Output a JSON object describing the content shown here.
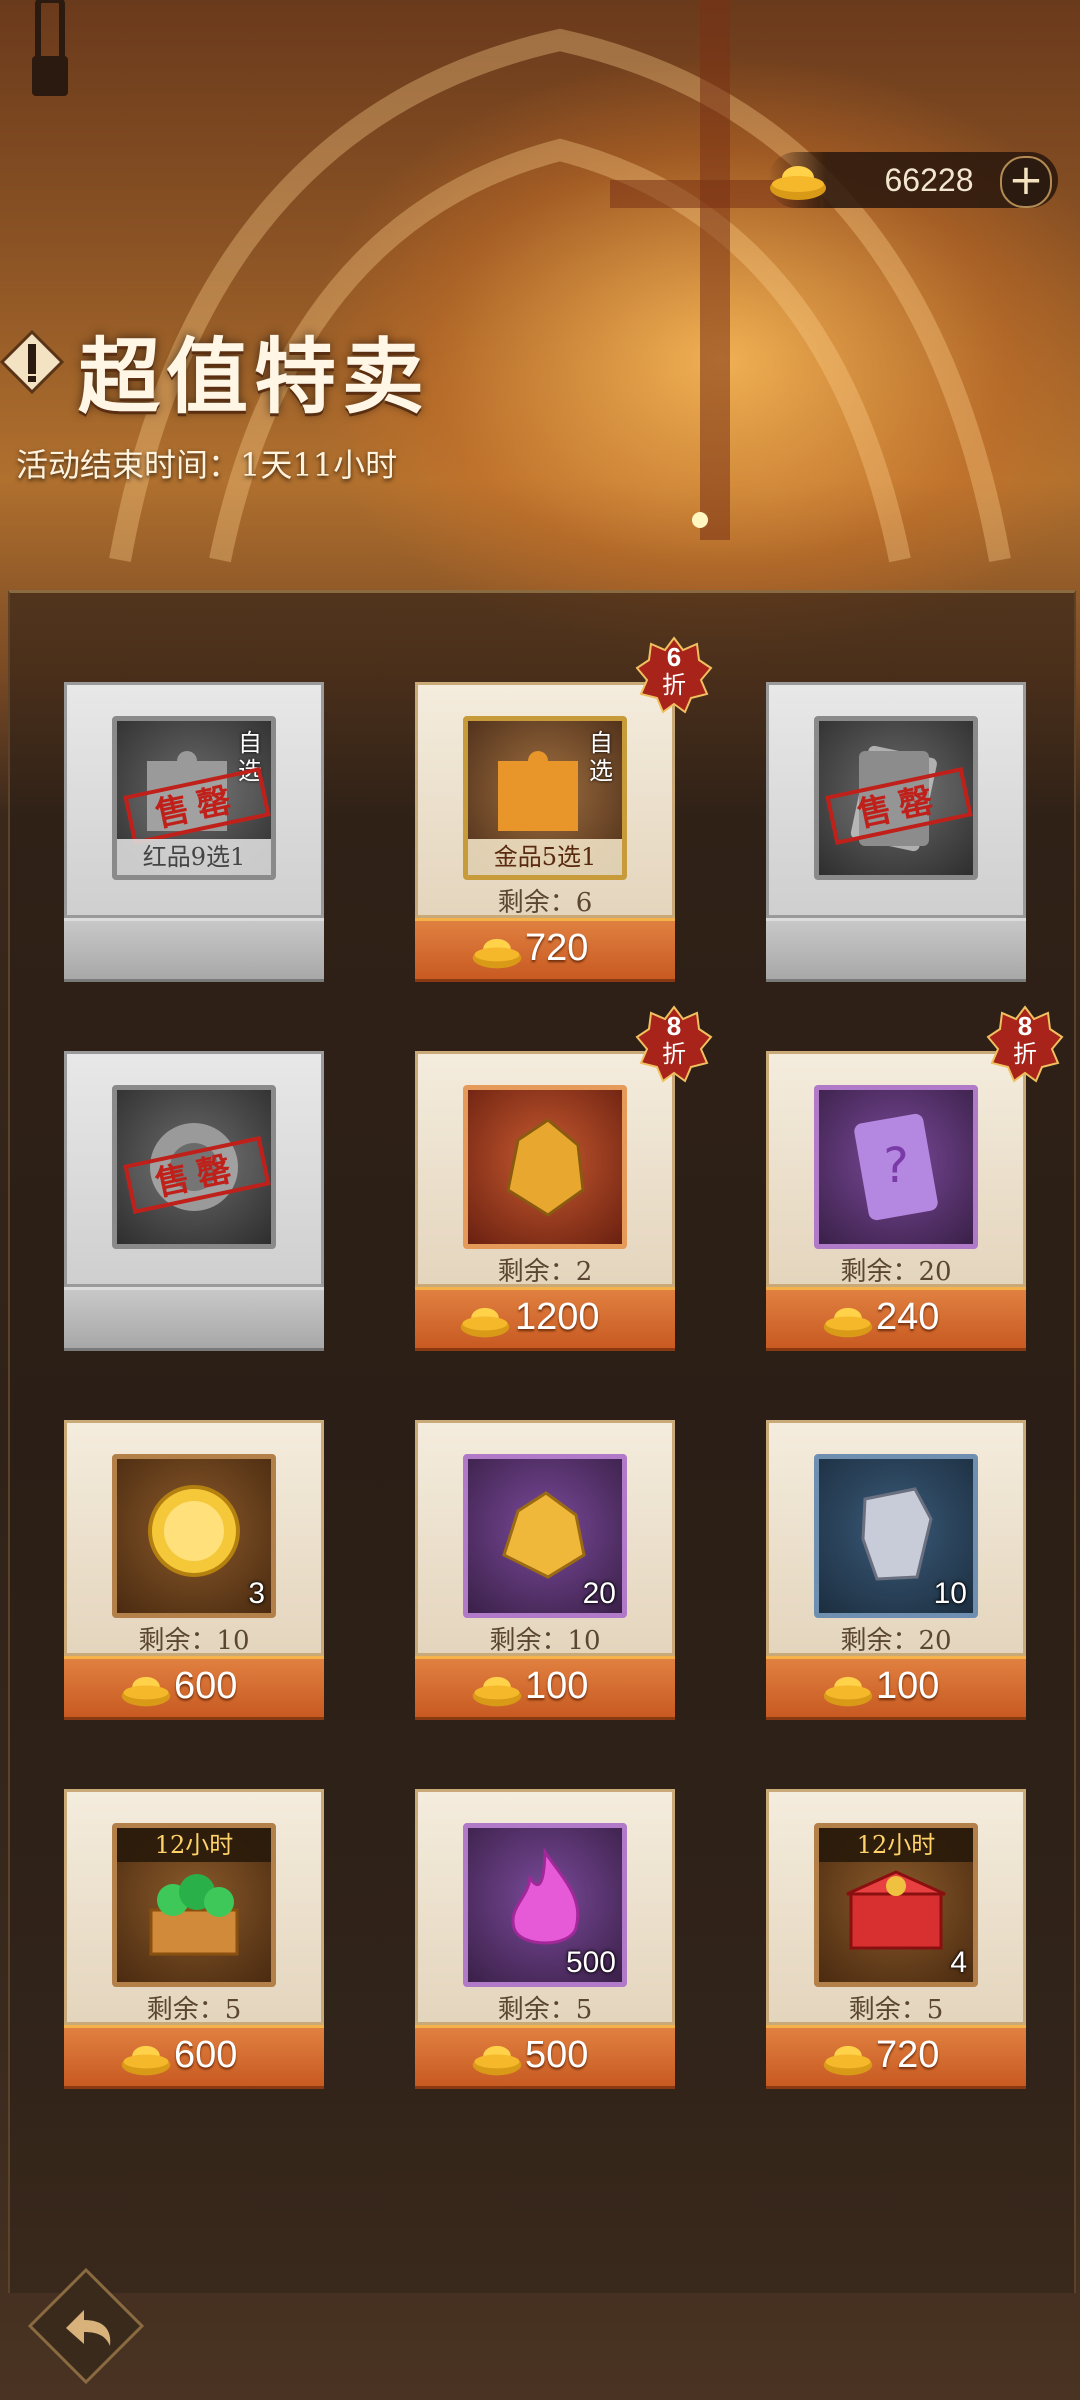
{
  "header": {
    "currency_amount": "66228",
    "add_label": "+",
    "title": "超值特卖",
    "subtitle": "活动结束时间：1天11小时"
  },
  "colors": {
    "price_bar": "#d0682a",
    "card_paper": "#efe5d3",
    "sold_grey": "#d6d6d6",
    "discount_badge": "#a8241a"
  },
  "items": [
    {
      "caption": "红品9选1",
      "self_pick": "自选",
      "stamp": "售罄",
      "sold_out": true
    },
    {
      "caption": "金品5选1",
      "self_pick": "自选",
      "remaining": "剩余：6",
      "price": "720",
      "discount": "6",
      "discount_unit": "折"
    },
    {
      "stamp": "售罄",
      "sold_out": true
    },
    {
      "stamp": "售罄",
      "sold_out": true
    },
    {
      "remaining": "剩余：2",
      "price": "1200",
      "discount": "8",
      "discount_unit": "折"
    },
    {
      "remaining": "剩余：20",
      "price": "240",
      "discount": "8",
      "discount_unit": "折"
    },
    {
      "count": "3",
      "remaining": "剩余：10",
      "price": "600"
    },
    {
      "count": "20",
      "remaining": "剩余：10",
      "price": "100"
    },
    {
      "count": "10",
      "remaining": "剩余：20",
      "price": "100"
    },
    {
      "timer": "12小时",
      "remaining": "剩余：5",
      "price": "600"
    },
    {
      "count": "500",
      "remaining": "剩余：5",
      "price": "500"
    },
    {
      "timer": "12小时",
      "count": "4",
      "remaining": "剩余：5",
      "price": "720"
    }
  ]
}
